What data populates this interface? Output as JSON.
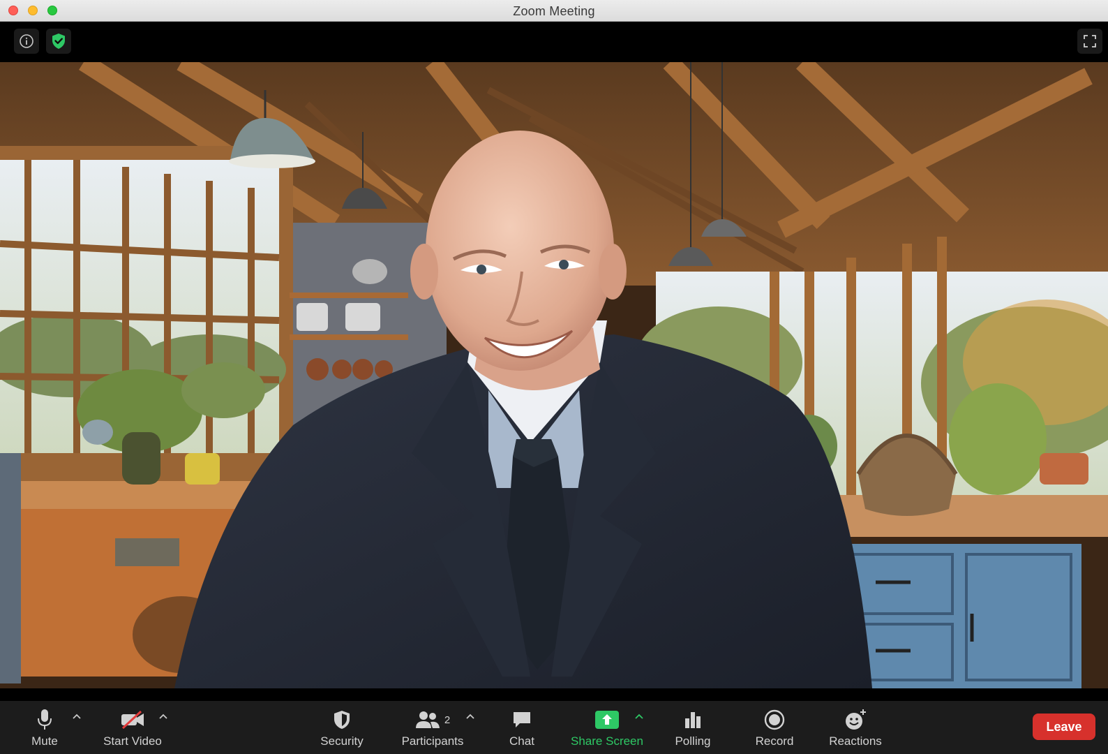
{
  "window": {
    "title": "Zoom Meeting"
  },
  "top_bar": {
    "info_icon": "info-icon",
    "security_shield_icon": "shield-check-icon",
    "fullscreen_icon": "fullscreen-icon",
    "shield_color": "#2ec865"
  },
  "video": {
    "scene": "Participant video with virtual background"
  },
  "toolbar": {
    "mute_label": "Mute",
    "start_video_label": "Start Video",
    "security_label": "Security",
    "participants_label": "Participants",
    "participants_count": "2",
    "chat_label": "Chat",
    "share_screen_label": "Share Screen",
    "polling_label": "Polling",
    "record_label": "Record",
    "reactions_label": "Reactions",
    "leave_label": "Leave"
  },
  "colors": {
    "toolbar_bg": "#1c1c1c",
    "share_green": "#2ec865",
    "leave_red": "#d7312c",
    "video_off_red": "#e23b3b"
  }
}
